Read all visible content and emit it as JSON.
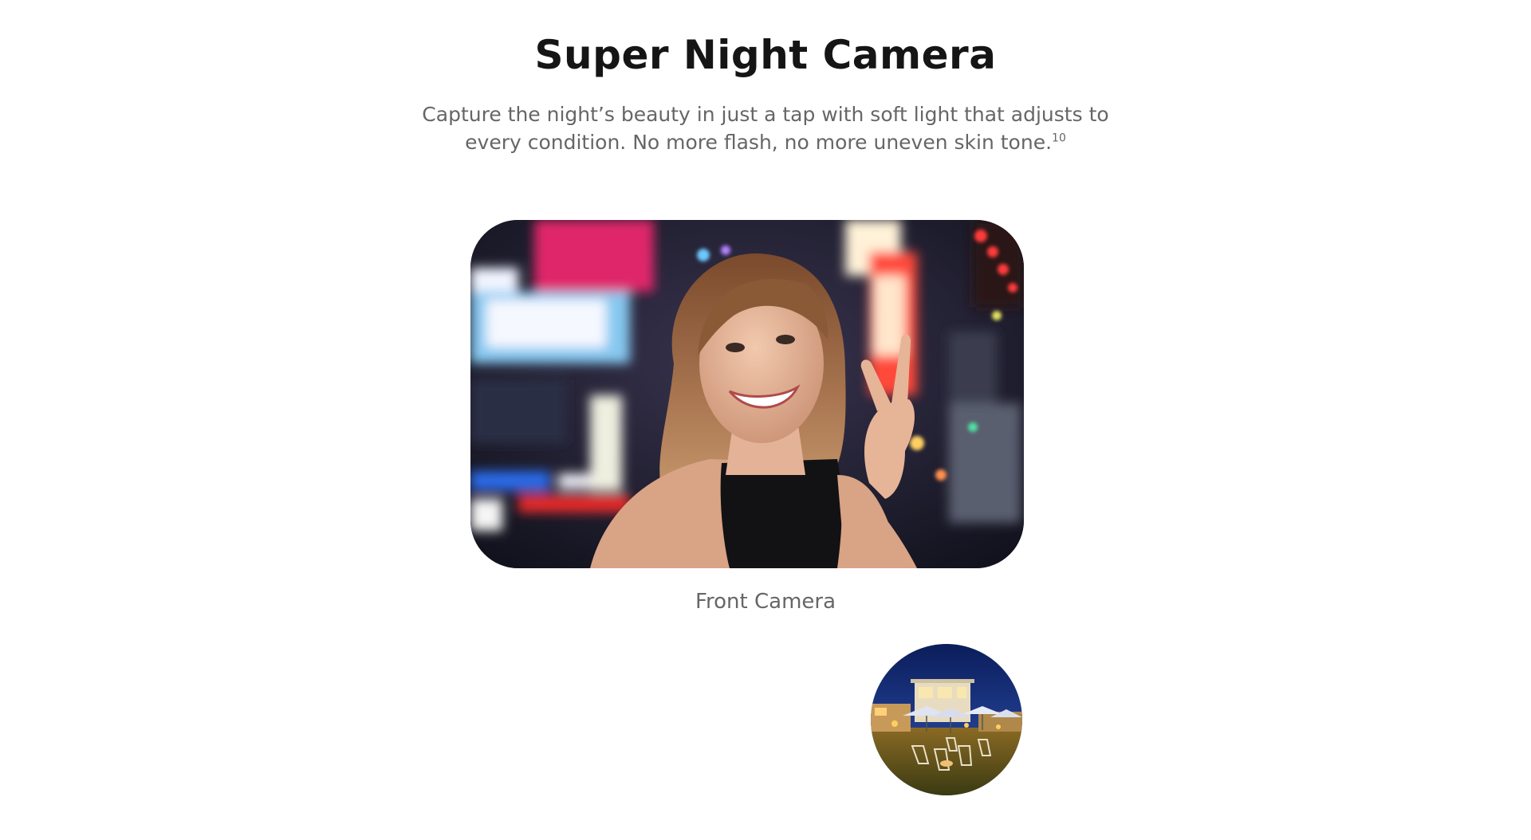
{
  "section": {
    "title": "Super Night Camera",
    "description": "Capture the night’s beauty in just a tap with soft light that adjusts to every condition. No more flash, no more uneven skin tone.",
    "footnote": "10"
  },
  "main_photo": {
    "subject": "selfie of smiling woman making peace sign in neon-lit city at night",
    "caption": "Front Camera"
  },
  "thumbnail": {
    "subject": "rooftop night scene with umbrellas and chairs under a dark blue sky"
  },
  "colors": {
    "title": "#151515",
    "body_text": "#666666",
    "background": "#ffffff"
  }
}
